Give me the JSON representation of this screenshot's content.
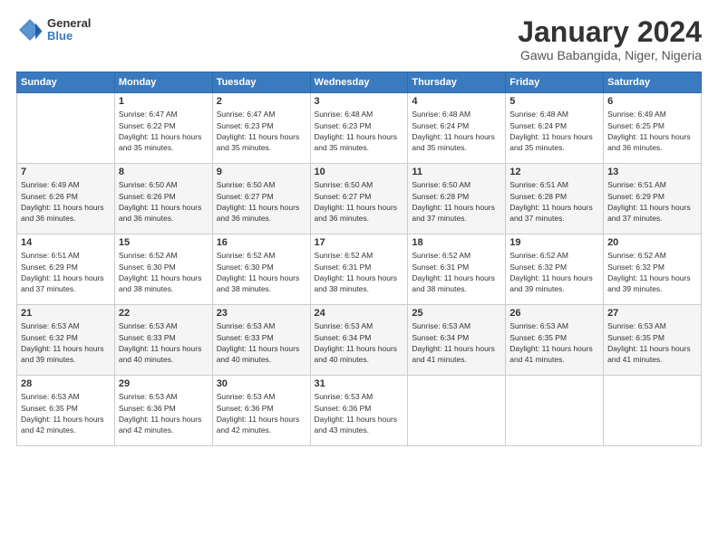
{
  "header": {
    "logo": {
      "general": "General",
      "blue": "Blue"
    },
    "title": "January 2024",
    "location": "Gawu Babangida, Niger, Nigeria"
  },
  "weekdays": [
    "Sunday",
    "Monday",
    "Tuesday",
    "Wednesday",
    "Thursday",
    "Friday",
    "Saturday"
  ],
  "weeks": [
    [
      null,
      {
        "day": 1,
        "sunrise": "6:47 AM",
        "sunset": "6:22 PM",
        "daylight": "11 hours and 35 minutes."
      },
      {
        "day": 2,
        "sunrise": "6:47 AM",
        "sunset": "6:23 PM",
        "daylight": "11 hours and 35 minutes."
      },
      {
        "day": 3,
        "sunrise": "6:48 AM",
        "sunset": "6:23 PM",
        "daylight": "11 hours and 35 minutes."
      },
      {
        "day": 4,
        "sunrise": "6:48 AM",
        "sunset": "6:24 PM",
        "daylight": "11 hours and 35 minutes."
      },
      {
        "day": 5,
        "sunrise": "6:48 AM",
        "sunset": "6:24 PM",
        "daylight": "11 hours and 35 minutes."
      },
      {
        "day": 6,
        "sunrise": "6:49 AM",
        "sunset": "6:25 PM",
        "daylight": "11 hours and 36 minutes."
      }
    ],
    [
      {
        "day": 7,
        "sunrise": "6:49 AM",
        "sunset": "6:26 PM",
        "daylight": "11 hours and 36 minutes."
      },
      {
        "day": 8,
        "sunrise": "6:50 AM",
        "sunset": "6:26 PM",
        "daylight": "11 hours and 36 minutes."
      },
      {
        "day": 9,
        "sunrise": "6:50 AM",
        "sunset": "6:27 PM",
        "daylight": "11 hours and 36 minutes."
      },
      {
        "day": 10,
        "sunrise": "6:50 AM",
        "sunset": "6:27 PM",
        "daylight": "11 hours and 36 minutes."
      },
      {
        "day": 11,
        "sunrise": "6:50 AM",
        "sunset": "6:28 PM",
        "daylight": "11 hours and 37 minutes."
      },
      {
        "day": 12,
        "sunrise": "6:51 AM",
        "sunset": "6:28 PM",
        "daylight": "11 hours and 37 minutes."
      },
      {
        "day": 13,
        "sunrise": "6:51 AM",
        "sunset": "6:29 PM",
        "daylight": "11 hours and 37 minutes."
      }
    ],
    [
      {
        "day": 14,
        "sunrise": "6:51 AM",
        "sunset": "6:29 PM",
        "daylight": "11 hours and 37 minutes."
      },
      {
        "day": 15,
        "sunrise": "6:52 AM",
        "sunset": "6:30 PM",
        "daylight": "11 hours and 38 minutes."
      },
      {
        "day": 16,
        "sunrise": "6:52 AM",
        "sunset": "6:30 PM",
        "daylight": "11 hours and 38 minutes."
      },
      {
        "day": 17,
        "sunrise": "6:52 AM",
        "sunset": "6:31 PM",
        "daylight": "11 hours and 38 minutes."
      },
      {
        "day": 18,
        "sunrise": "6:52 AM",
        "sunset": "6:31 PM",
        "daylight": "11 hours and 38 minutes."
      },
      {
        "day": 19,
        "sunrise": "6:52 AM",
        "sunset": "6:32 PM",
        "daylight": "11 hours and 39 minutes."
      },
      {
        "day": 20,
        "sunrise": "6:52 AM",
        "sunset": "6:32 PM",
        "daylight": "11 hours and 39 minutes."
      }
    ],
    [
      {
        "day": 21,
        "sunrise": "6:53 AM",
        "sunset": "6:32 PM",
        "daylight": "11 hours and 39 minutes."
      },
      {
        "day": 22,
        "sunrise": "6:53 AM",
        "sunset": "6:33 PM",
        "daylight": "11 hours and 40 minutes."
      },
      {
        "day": 23,
        "sunrise": "6:53 AM",
        "sunset": "6:33 PM",
        "daylight": "11 hours and 40 minutes."
      },
      {
        "day": 24,
        "sunrise": "6:53 AM",
        "sunset": "6:34 PM",
        "daylight": "11 hours and 40 minutes."
      },
      {
        "day": 25,
        "sunrise": "6:53 AM",
        "sunset": "6:34 PM",
        "daylight": "11 hours and 41 minutes."
      },
      {
        "day": 26,
        "sunrise": "6:53 AM",
        "sunset": "6:35 PM",
        "daylight": "11 hours and 41 minutes."
      },
      {
        "day": 27,
        "sunrise": "6:53 AM",
        "sunset": "6:35 PM",
        "daylight": "11 hours and 41 minutes."
      }
    ],
    [
      {
        "day": 28,
        "sunrise": "6:53 AM",
        "sunset": "6:35 PM",
        "daylight": "11 hours and 42 minutes."
      },
      {
        "day": 29,
        "sunrise": "6:53 AM",
        "sunset": "6:36 PM",
        "daylight": "11 hours and 42 minutes."
      },
      {
        "day": 30,
        "sunrise": "6:53 AM",
        "sunset": "6:36 PM",
        "daylight": "11 hours and 42 minutes."
      },
      {
        "day": 31,
        "sunrise": "6:53 AM",
        "sunset": "6:36 PM",
        "daylight": "11 hours and 43 minutes."
      },
      null,
      null,
      null
    ]
  ]
}
